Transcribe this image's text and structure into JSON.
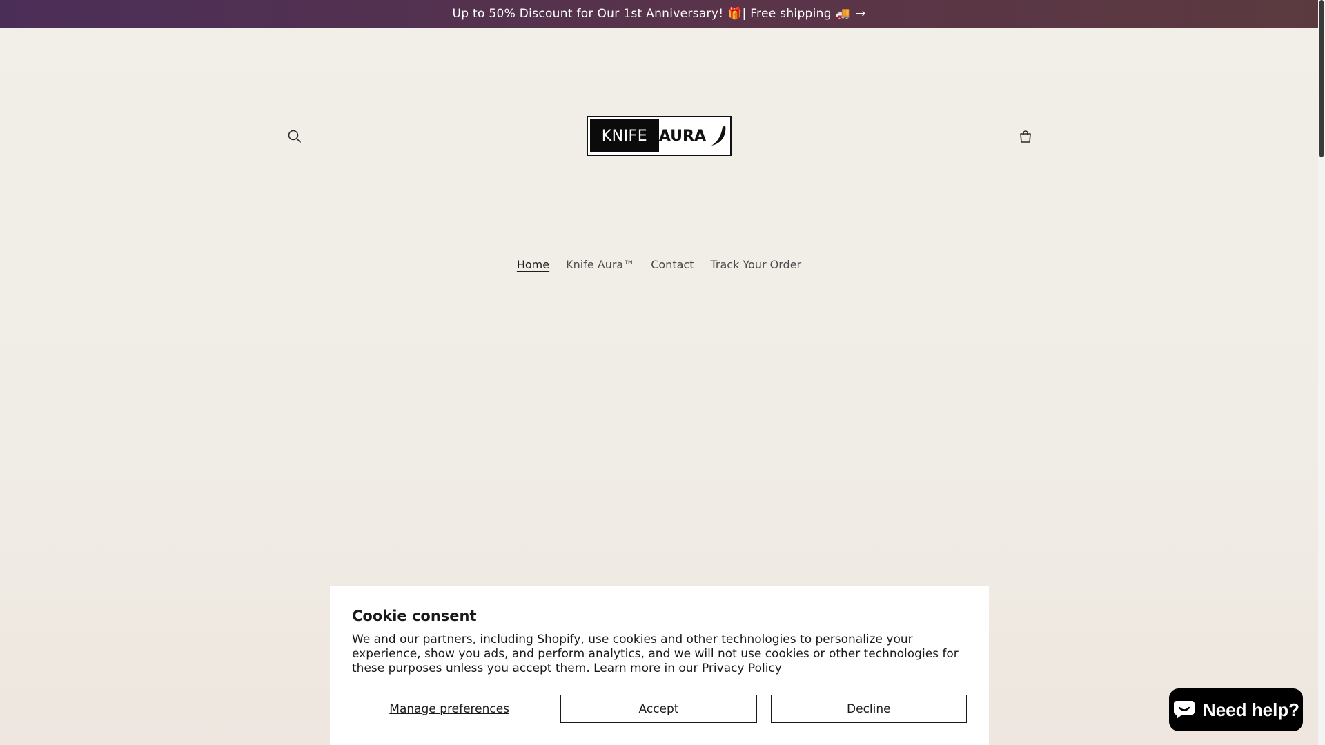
{
  "announcement": {
    "text": "Up to 50% Discount for Our 1st Anniversary! 🎁| Free shipping 🚚",
    "arrow": "→"
  },
  "header": {
    "search_icon": "search-icon",
    "cart_icon": "cart-icon",
    "logo": {
      "left_text": "KNIFE",
      "right_text": "AURA"
    }
  },
  "nav": {
    "items": [
      {
        "label": "Home",
        "active": true
      },
      {
        "label": "Knife Aura™",
        "active": false
      },
      {
        "label": "Contact",
        "active": false
      },
      {
        "label": "Track Your Order",
        "active": false
      }
    ]
  },
  "cookie": {
    "title": "Cookie consent",
    "body": "We and our partners, including Shopify, use cookies and other technologies to personalize your experience, show you ads, and perform analytics, and we will not use cookies or other technologies for these purposes unless you accept them. Learn more in our ",
    "privacy_link": "Privacy Policy",
    "manage_label": "Manage preferences",
    "accept_label": "Accept",
    "decline_label": "Decline"
  },
  "chat": {
    "label": "Need help?",
    "icon": "chat-bubble-icon"
  },
  "colors": {
    "announcement_bg": "#4b2e58",
    "page_bg": "#f1efe8",
    "chat_bg": "#000000"
  }
}
